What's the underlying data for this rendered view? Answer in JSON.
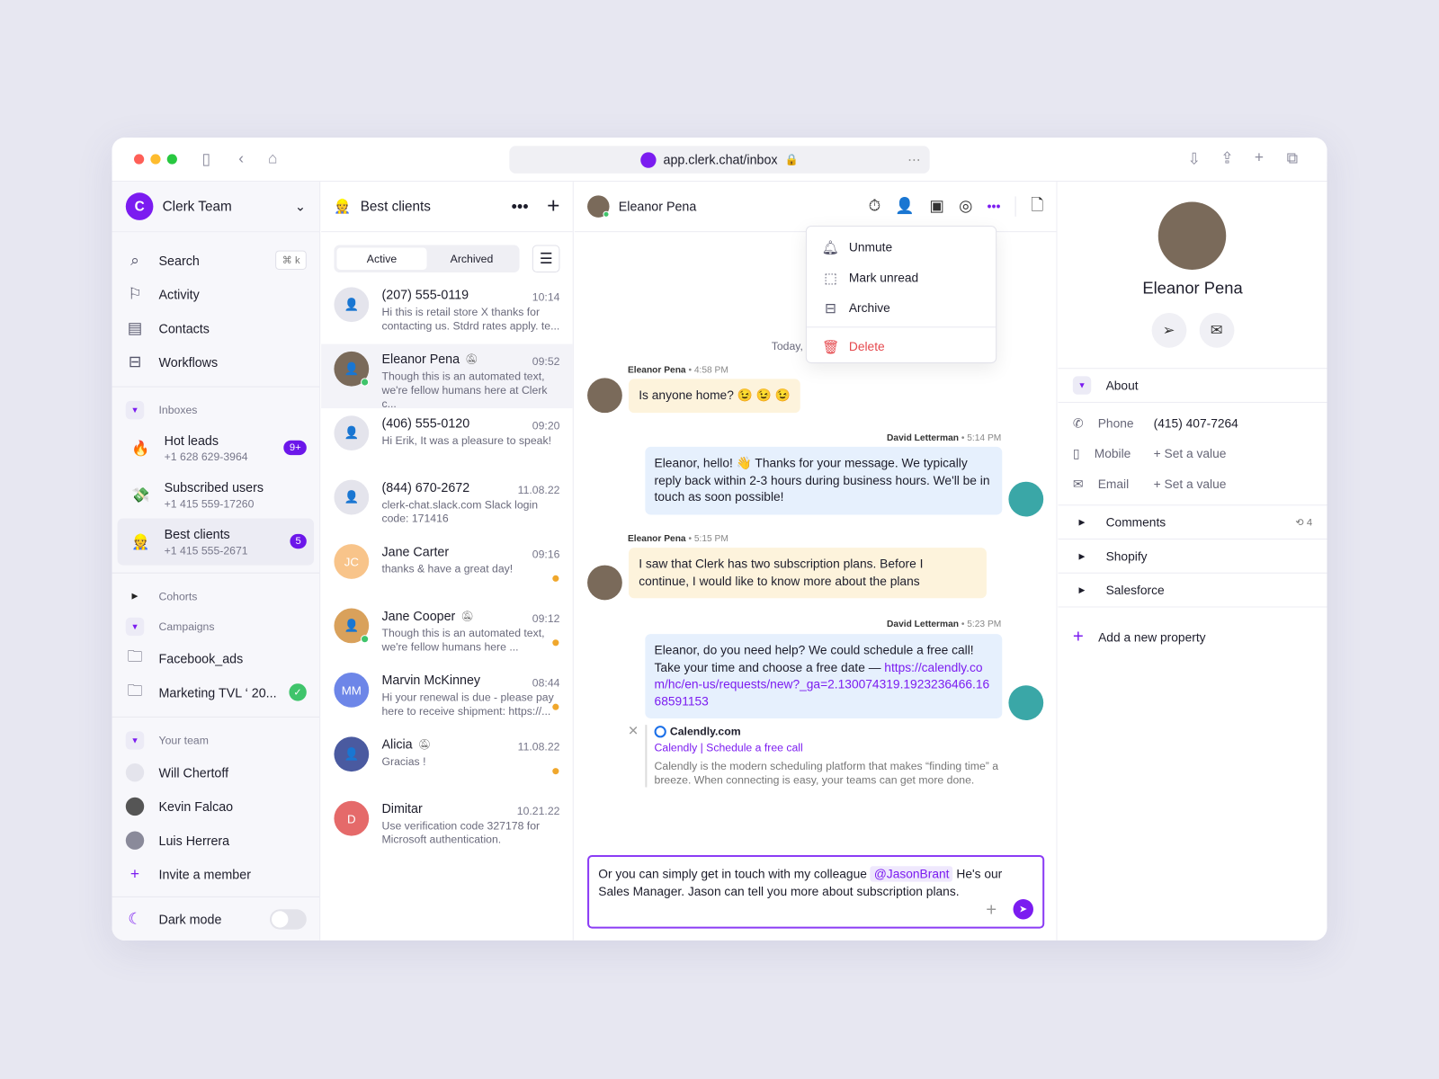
{
  "browser": {
    "url": "app.clerk.chat/inbox"
  },
  "sidebar": {
    "team": "Clerk Team",
    "search": "Search",
    "shortcut": "⌘ k",
    "nav": [
      {
        "label": "Activity",
        "icon": "flag-icon"
      },
      {
        "label": "Contacts",
        "icon": "contacts-icon"
      },
      {
        "label": "Workflows",
        "icon": "workflows-icon"
      }
    ],
    "inboxes_label": "Inboxes",
    "inboxes": [
      {
        "name": "Hot leads",
        "phone": "+1 628 629-3964",
        "badge": "9+",
        "emoji": "🔥"
      },
      {
        "name": "Subscribed users",
        "phone": "+1 415 559-17260",
        "badge": "",
        "emoji": "💸"
      },
      {
        "name": "Best clients",
        "phone": "+1 415 555-2671",
        "badge": "5",
        "emoji": "👷"
      }
    ],
    "cohorts": "Cohorts",
    "campaigns": "Campaigns",
    "campaign_items": [
      "Facebook_ads",
      "Marketing TVL ‘ 20..."
    ],
    "team_label": "Your team",
    "members": [
      "Will Chertoff",
      "Kevin Falcao",
      "Luis Herrera"
    ],
    "invite": "Invite a member",
    "dark_mode": "Dark mode",
    "dark_mode_on": false
  },
  "list": {
    "title": "Best clients",
    "tabs": [
      "Active",
      "Archived"
    ],
    "active_tab": "Active",
    "items": [
      {
        "name": "(207) 555-0119",
        "time": "10:14",
        "preview": "Hi this is retail store X thanks for contacting us. Stdrd rates apply. te...",
        "initials": "",
        "color": "#e4e4ec",
        "muted": false,
        "unread": false,
        "online": false
      },
      {
        "name": "Eleanor Pena",
        "time": "09:52",
        "preview": "Though this is an automated text, we're fellow humans here at Clerk c...",
        "initials": "",
        "color": "#7a6a5a",
        "muted": true,
        "unread": false,
        "online": true
      },
      {
        "name": "(406) 555-0120",
        "time": "09:20",
        "preview": "Hi Erik, It was a pleasure to speak!",
        "initials": "",
        "color": "#e4e4ec",
        "muted": false,
        "unread": false,
        "online": false
      },
      {
        "name": "(844) 670-2672",
        "time": "11.08.22",
        "preview": "clerk-chat.slack.com Slack login code: 171416",
        "initials": "",
        "color": "#e4e4ec",
        "muted": false,
        "unread": false,
        "online": false
      },
      {
        "name": "Jane Carter",
        "time": "09:16",
        "preview": "thanks & have a great day!",
        "initials": "JC",
        "color": "#f8c48a",
        "muted": false,
        "unread": true,
        "online": false
      },
      {
        "name": "Jane Cooper",
        "time": "09:12",
        "preview": "Though this is an automated text, we're fellow humans here ...",
        "initials": "",
        "color": "#d9a15b",
        "muted": true,
        "unread": true,
        "online": true
      },
      {
        "name": "Marvin McKinney",
        "time": "08:44",
        "preview": "Hi your renewal is due - please pay here to receive shipment: https://...",
        "initials": "MM",
        "color": "#6d86e8",
        "muted": false,
        "unread": true,
        "online": false
      },
      {
        "name": "Alicia",
        "time": "11.08.22",
        "preview": "Gracias !",
        "initials": "",
        "color": "#4a5aa0",
        "muted": true,
        "unread": true,
        "online": false
      },
      {
        "name": "Dimitar",
        "time": "10.21.22",
        "preview": "Use verification code 327178 for Microsoft authentication.",
        "initials": "D",
        "color": "#e56a6a",
        "muted": false,
        "unread": false,
        "online": false
      }
    ]
  },
  "chat": {
    "contact": "Eleanor Pena",
    "date": "Today, 6 February",
    "menu": [
      "Unmute",
      "Mark unread",
      "Archive"
    ],
    "menu_delete": "Delete",
    "messages": [
      {
        "author": "Eleanor Pena",
        "time": "4:58 PM",
        "text": "Is anyone home? 😉 😉 😉"
      },
      {
        "author": "David Letterman",
        "time": "5:14 PM",
        "text": "Eleanor, hello! 👋 Thanks for your message. We typically reply back within 2-3 hours during business hours. We'll be in touch as soon possible!"
      },
      {
        "author": "Eleanor Pena",
        "time": "5:15 PM",
        "text": "I saw that Clerk has two subscription plans. Before I continue, I would like to know more about the plans"
      },
      {
        "author": "David Letterman",
        "time": "5:23 PM",
        "text": "Eleanor, do you need help? We could schedule a free call! Take your time and choose a free date — ",
        "link": "https://calendly.com/hc/en-us/requests/new?_ga=2.130074319.1923236466.1668591153"
      }
    ],
    "preview": {
      "site": "Calendly.com",
      "title": "Calendly | Schedule a free call",
      "desc": "Calendly is the modern scheduling platform that makes “finding time” a breeze. When connecting is easy, your teams can get more done."
    },
    "composer": {
      "before": "Or you can simply get in touch with my colleague ",
      "mention": "@JasonBrant",
      "after": " He's our Sales Manager. Jason can tell you more about subscription plans."
    }
  },
  "profile": {
    "name": "Eleanor Pena",
    "about": "About",
    "fields": [
      {
        "label": "Phone",
        "value": "(415) 407-7264",
        "icon": "phone-icon",
        "set": true
      },
      {
        "label": "Mobile",
        "value": "+ Set a value",
        "icon": "mobile-icon",
        "set": false
      },
      {
        "label": "Email",
        "value": "+ Set a value",
        "icon": "email-icon",
        "set": false
      }
    ],
    "sections": [
      {
        "label": "Comments",
        "count": "4"
      },
      {
        "label": "Shopify",
        "count": ""
      },
      {
        "label": "Salesforce",
        "count": ""
      }
    ],
    "add": "Add a new property"
  },
  "colors": {
    "accent": "#7b1cf0",
    "delete": "#e5484d",
    "outgoing": "#e6f0fd",
    "incoming": "#fdf3dc"
  }
}
